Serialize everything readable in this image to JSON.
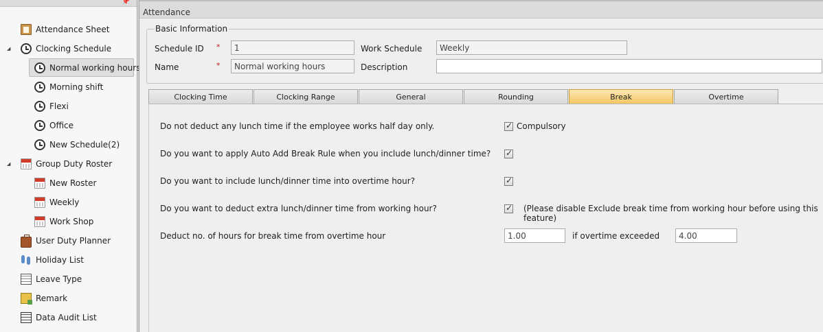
{
  "sidebar": {
    "pin_icon": "pin-icon",
    "items": [
      {
        "label": "Attendance Sheet",
        "icon": "sheet-icon"
      },
      {
        "label": "Clocking Schedule",
        "icon": "clock-icon",
        "expander": "◢"
      },
      {
        "label": "Normal working hours",
        "icon": "clock-icon",
        "selected": true
      },
      {
        "label": "Morning shift",
        "icon": "clock-icon"
      },
      {
        "label": "Flexi",
        "icon": "clock-icon"
      },
      {
        "label": "Office",
        "icon": "clock-icon"
      },
      {
        "label": "New Schedule(2)",
        "icon": "clock-icon"
      },
      {
        "label": "Group Duty Roster",
        "icon": "calendar-icon",
        "expander": "◢"
      },
      {
        "label": "New Roster",
        "icon": "calendar-icon"
      },
      {
        "label": "Weekly",
        "icon": "calendar-icon"
      },
      {
        "label": "Work Shop",
        "icon": "calendar-icon"
      },
      {
        "label": "User Duty Planner",
        "icon": "briefcase-icon"
      },
      {
        "label": "Holiday List",
        "icon": "footprints-icon"
      },
      {
        "label": "Leave Type",
        "icon": "grid-icon"
      },
      {
        "label": "Remark",
        "icon": "note-icon"
      },
      {
        "label": "Data Audit List",
        "icon": "list-icon"
      }
    ]
  },
  "main": {
    "title": "Attendance",
    "basic_info": {
      "legend": "Basic Information",
      "schedule_id_label": "Schedule ID",
      "schedule_id_value": "1",
      "name_label": "Name",
      "name_value": "Normal working hours",
      "required_mark": "*",
      "work_schedule_label": "Work Schedule",
      "work_schedule_value": "Weekly",
      "description_label": "Description",
      "description_value": ""
    },
    "tabs": [
      "Clocking Time",
      "Clocking Range",
      "General",
      "Rounding",
      "Break",
      "Overtime"
    ],
    "active_tab": "Break",
    "break": {
      "q1": "Do not deduct any lunch time if the employee works half day only.",
      "q1_checkbox_label": "Compulsory",
      "q1_checked": true,
      "q2": "Do you want to apply Auto Add Break Rule when you include lunch/dinner time?",
      "q2_checked": true,
      "q3": "Do you want to include lunch/dinner time into overtime hour?",
      "q3_checked": true,
      "q4": "Do you want to deduct extra lunch/dinner time from working hour?",
      "q4_checked": true,
      "q4_note": "(Please disable Exclude break time from working hour before using this feature)",
      "deduct_label": "Deduct no. of hours for break time from overtime hour",
      "deduct_value": "1.00",
      "exceeded_label": "if overtime exceeded",
      "exceeded_value": "4.00"
    }
  },
  "colors": {
    "active_tab": "#f3c45f",
    "required": "#d12020",
    "panel_bg": "#efefef"
  }
}
